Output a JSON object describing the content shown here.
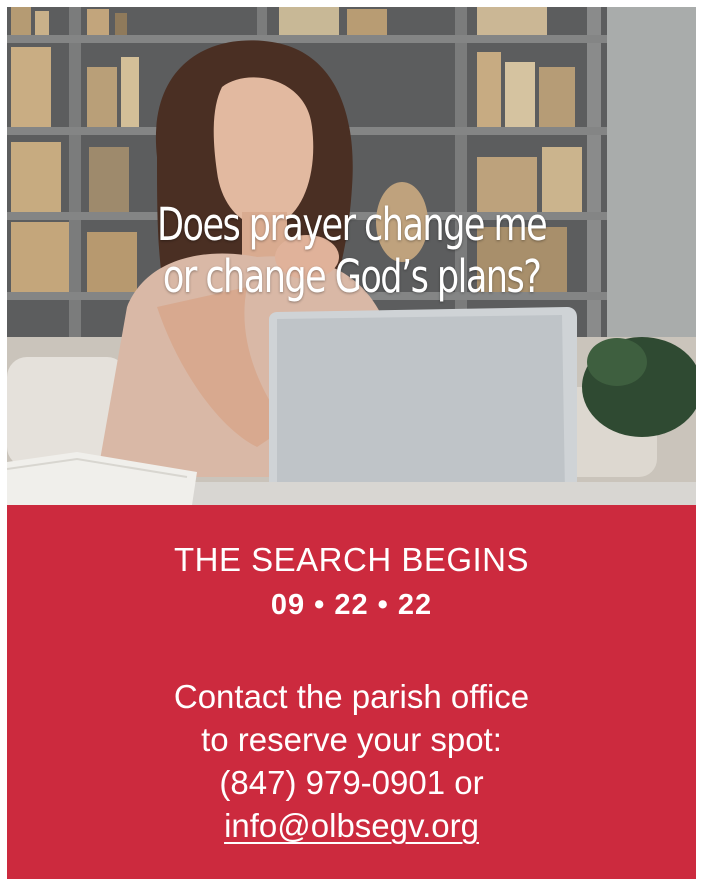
{
  "photo": {
    "headline_line1": "Does prayer change me",
    "headline_line2": "or change God’s plans?"
  },
  "event": {
    "kicker": "THE SEARCH BEGINS",
    "date": "09 • 22 • 22"
  },
  "contact": {
    "line1": "Contact the parish office",
    "line2": "to reserve your spot:",
    "phone_line": "(847) 979-0901 or",
    "email": "info@olbsegv.org"
  },
  "colors": {
    "panel_red": "#cc2a3e",
    "text": "#ffffff"
  }
}
